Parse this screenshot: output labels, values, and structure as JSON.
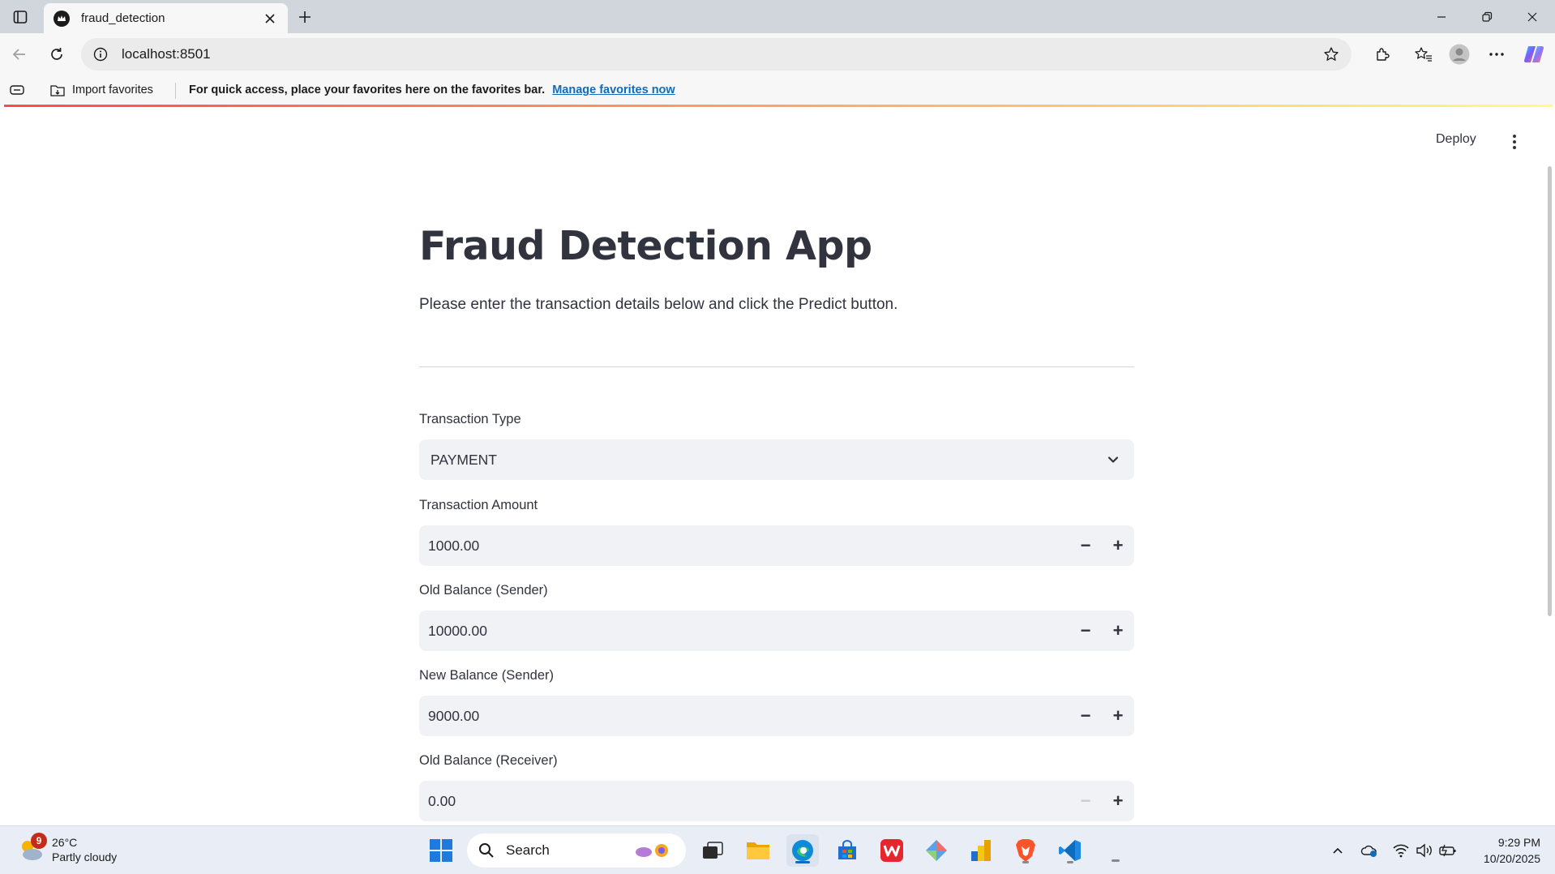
{
  "browser": {
    "tab_title": "fraud_detection",
    "url": "localhost:8501",
    "favorites_bar": {
      "import_label": "Import favorites",
      "message": "For quick access, place your favorites here on the favorites bar.",
      "link_text": "Manage favorites now"
    }
  },
  "app": {
    "header": {
      "deploy_label": "Deploy"
    },
    "title": "Fraud Detection App",
    "intro": "Please enter the transaction details below and click the Predict button.",
    "fields": {
      "transaction_type": {
        "label": "Transaction Type",
        "value": "PAYMENT"
      },
      "transaction_amount": {
        "label": "Transaction Amount",
        "value": "1000.00"
      },
      "old_balance_sender": {
        "label": "Old Balance (Sender)",
        "value": "10000.00"
      },
      "new_balance_sender": {
        "label": "New Balance (Sender)",
        "value": "9000.00"
      },
      "old_balance_receiver": {
        "label": "Old Balance (Receiver)",
        "value": "0.00"
      }
    },
    "stepper": {
      "minus": "−",
      "plus": "+"
    },
    "accent_color": "#ff4b4b"
  },
  "taskbar": {
    "weather": {
      "temp": "26°C",
      "condition": "Partly cloudy",
      "badge": "9"
    },
    "search_placeholder": "Search",
    "clock": {
      "time": "9:29 PM",
      "date": "10/20/2025"
    }
  }
}
